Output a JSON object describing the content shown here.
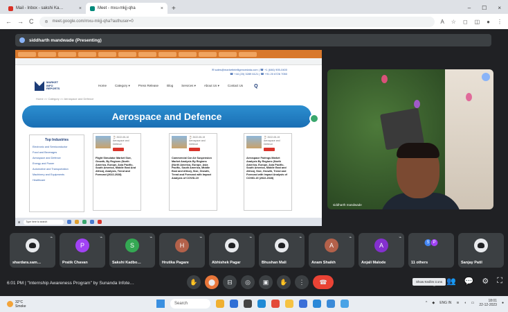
{
  "browser": {
    "tabs": [
      {
        "label": "Mail - Inbox - sakshi Ka…",
        "close": "×",
        "active": false
      },
      {
        "label": "Meet - mxu-mkjj-qha",
        "close": "×",
        "active": true
      }
    ],
    "new_tab": "+",
    "window_controls": [
      "–",
      "☐",
      "×"
    ],
    "url": "meet.google.com/mxu-mkjj-qha?authuser=0",
    "nav_icons": [
      "←",
      "→",
      "C"
    ]
  },
  "meet": {
    "presenting_label": "siddharth mandwade (Presenting)",
    "shared_screen": {
      "contact_line1": "✉ sales@marketintelligencedata.com | ☎ +1 (646) 905-0400",
      "contact_line2": "☎ +44 (20) 3289 6121 | ☎ +91 20 6726 7050",
      "logo_text": "MARKET INFO REPORTS",
      "nav": [
        "Home",
        "Category ▾",
        "Press Release",
        "Blog",
        "Services ▾",
        "About Us ▾",
        "Contact Us"
      ],
      "search_icon_glyph": "Q",
      "breadcrumb": "Home >> Category >> Aerospace and Defence",
      "hero_title": "Aerospace and Defence",
      "top_industries_title": "Top Industries",
      "top_industries": [
        "Electronic and Semiconductor",
        "Food and Beverages",
        "Aerospace and Defence",
        "Energy and Power",
        "Automotive and Transportation",
        "Machinery and Equipments",
        "Healthcare"
      ],
      "cards": [
        {
          "meta1": "⌚ 2022-05-10",
          "meta2": "Aerospace and Defence",
          "title": "Flight Simulator Market Size, Growth, By Regions (North America, Europe, Asia Pacific, South America, Middle East And Africa), Analysis, Trend and Forecast (2022-2028)"
        },
        {
          "meta1": "⌚ 2022-05-19",
          "meta2": "Aerospace and Defence",
          "title": "Commercial Car Air Suspension Market Analysis By Regions (North America, Europe, Asia Pacific, South America, Middle East and Africa), Size, Growth, Trend and Forecast with Impact Analysis of COVID-19"
        },
        {
          "meta1": "⌚ 2022-05-19",
          "meta2": "Aerospace and Defence",
          "title": "Aerospace Fairings Market Analysis By Regions (North America, Europe, Asia Pacific, South America, Middle East and Africa), Size, Growth, Trend and Forecast with Impact Analysis of COVID-19 (2022-2028)"
        }
      ],
      "taskbar_search": "Type here to search"
    },
    "presenter_label": "siddharth mandwade",
    "participants": [
      {
        "name": "shardara.sam…",
        "initial": "",
        "color": "photo"
      },
      {
        "name": "Pratik Chavan",
        "initial": "P",
        "color": "#a142f4"
      },
      {
        "name": "Sakshi Kadbo…",
        "initial": "S",
        "color": "#34a853"
      },
      {
        "name": "Hrutika Pagare",
        "initial": "H",
        "color": "#b3614a"
      },
      {
        "name": "Abhishek Pagar",
        "initial": "",
        "color": "photo"
      },
      {
        "name": "Bhushan Mali",
        "initial": "",
        "color": "photo"
      },
      {
        "name": "Anam Shaikh",
        "initial": "A",
        "color": "#b3614a"
      },
      {
        "name": "Anjali Malode",
        "initial": "A",
        "color": "#8430ce"
      },
      {
        "name": "11 others",
        "initial": "",
        "color": "duo"
      },
      {
        "name": "Sanjay Patil",
        "initial": "",
        "color": "photo"
      }
    ],
    "others_initials": [
      "S",
      "P"
    ],
    "meeting_info": "6:01 PM | \"Internship Awareness Program\" by Sunanda Infote…",
    "tooltip": "Show Kedlim icons",
    "controls": [
      "✋",
      "⬤",
      "⊟",
      "◎",
      "▣",
      "✋",
      "⋮",
      "☎"
    ],
    "right_controls": [
      "ⓘ",
      "👥",
      "💬",
      "⚙",
      "⛶"
    ]
  },
  "taskbar": {
    "weather_temp": "32°C",
    "weather_desc": "Smoke",
    "search": "Search",
    "tray_lang": "ENG IN",
    "time": "18:01",
    "date": "22-12-2023"
  }
}
